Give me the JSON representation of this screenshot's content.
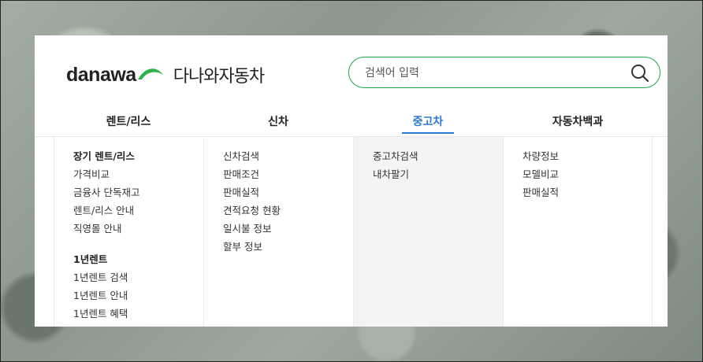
{
  "logo": {
    "brand": "danawa",
    "sub": "다나와자동차",
    "swoosh_color": "#2fb24a"
  },
  "search": {
    "placeholder": "검색어 입력",
    "value": ""
  },
  "accent_color": "#2d7ad6",
  "tabs": [
    {
      "label": "렌트/리스",
      "active": false
    },
    {
      "label": "신차",
      "active": false
    },
    {
      "label": "중고차",
      "active": true
    },
    {
      "label": "자동차백과",
      "active": false
    }
  ],
  "menu": {
    "rent": {
      "group1": {
        "title": "장기 렌트/리스",
        "items": [
          "가격비교",
          "금융사 단독재고",
          "렌트/리스 안내",
          "직영몰 안내"
        ]
      },
      "group2": {
        "title": "1년렌트",
        "items": [
          "1년렌트 검색",
          "1년렌트 안내",
          "1년렌트 혜택"
        ]
      }
    },
    "new_car": [
      "신차검색",
      "판매조건",
      "판매실적",
      "견적요청 현황",
      "일시불 정보",
      "할부 정보"
    ],
    "used_car": [
      "중고차검색",
      "내차팔기"
    ],
    "encyclopedia": [
      "차량정보",
      "모델비교",
      "판매실적"
    ]
  }
}
